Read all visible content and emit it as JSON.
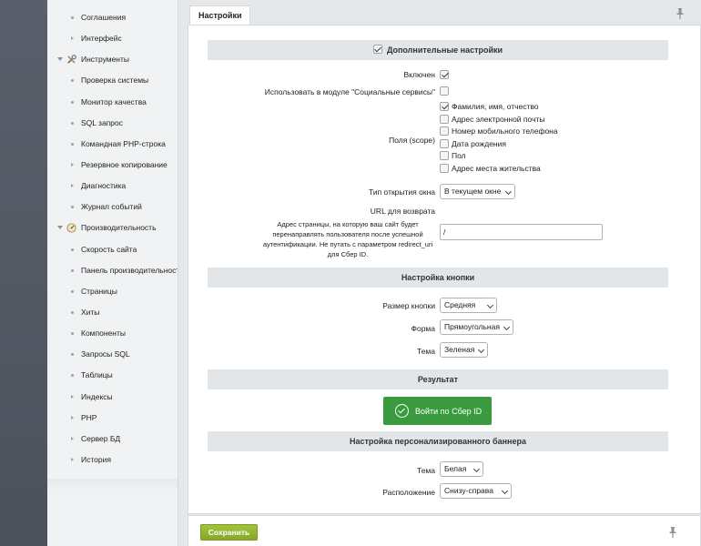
{
  "sidebar": {
    "items": [
      {
        "label": "Соглашения",
        "kind": "bullet"
      },
      {
        "label": "Интерфейс",
        "kind": "arrow"
      },
      {
        "label": "Инструменты",
        "kind": "section",
        "icon": "tools-icon"
      },
      {
        "label": "Проверка системы",
        "kind": "bullet"
      },
      {
        "label": "Монитор качества",
        "kind": "bullet"
      },
      {
        "label": "SQL запрос",
        "kind": "bullet"
      },
      {
        "label": "Командная PHP-строка",
        "kind": "bullet"
      },
      {
        "label": "Резервное копирование",
        "kind": "arrow"
      },
      {
        "label": "Диагностика",
        "kind": "arrow"
      },
      {
        "label": "Журнал событий",
        "kind": "bullet"
      },
      {
        "label": "Производительность",
        "kind": "section",
        "icon": "speedometer-icon"
      },
      {
        "label": "Скорость сайта",
        "kind": "bullet"
      },
      {
        "label": "Панель производительности",
        "kind": "bullet"
      },
      {
        "label": "Страницы",
        "kind": "bullet"
      },
      {
        "label": "Хиты",
        "kind": "bullet"
      },
      {
        "label": "Компоненты",
        "kind": "bullet"
      },
      {
        "label": "Запросы SQL",
        "kind": "bullet"
      },
      {
        "label": "Таблицы",
        "kind": "bullet"
      },
      {
        "label": "Индексы",
        "kind": "arrow"
      },
      {
        "label": "PHP",
        "kind": "arrow"
      },
      {
        "label": "Сервер БД",
        "kind": "arrow"
      },
      {
        "label": "История",
        "kind": "arrow"
      }
    ]
  },
  "tab": {
    "label": "Настройки"
  },
  "sections": {
    "additional": "Дополнительные настройки",
    "button": "Настройка кнопки",
    "result": "Результат",
    "banner": "Настройка персонализированного баннера"
  },
  "additional": {
    "enabled_label": "Включен",
    "enabled_checked": true,
    "social_label": "Использовать в модуле \"Социальные сервисы\"",
    "social_checked": false,
    "scope_label": "Поля (scope)",
    "scope_options": [
      {
        "label": "Фамилия, имя, отчество",
        "checked": true
      },
      {
        "label": "Адрес электронной почты",
        "checked": false
      },
      {
        "label": "Номер мобильного телефона",
        "checked": false
      },
      {
        "label": "Дата рождения",
        "checked": false
      },
      {
        "label": "Пол",
        "checked": false
      },
      {
        "label": "Адрес места жительства",
        "checked": false
      }
    ],
    "window_type_label": "Тип открытия окна",
    "window_type_value": "В текущем окне",
    "return_url_label": "URL для возврата",
    "return_url_desc": "Адрес страницы, на которую ваш сайт будет перенаправлять пользователя после успешной аутентификации. Не путать с параметром redirect_uri для Сбер ID.",
    "return_url_value": "/"
  },
  "button_settings": {
    "size_label": "Размер кнопки",
    "size_value": "Средняя",
    "shape_label": "Форма",
    "shape_value": "Прямоугольная",
    "theme_label": "Тема",
    "theme_value": "Зеленая"
  },
  "result": {
    "sber_button_label": "Войти по Сбер ID",
    "sber_color": "#3a9a3e"
  },
  "banner": {
    "theme_label": "Тема",
    "theme_value": "Белая",
    "position_label": "Расположение",
    "position_value": "Снизу-справа"
  },
  "footer": {
    "save_label": "Сохранить",
    "save_color": "#94b733"
  }
}
